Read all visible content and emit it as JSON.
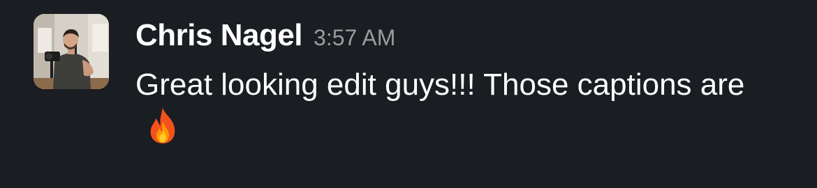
{
  "message": {
    "sender": "Chris Nagel",
    "timestamp": "3:57 AM",
    "text": "Great looking edit guys!!! Those captions are",
    "emoji": "fire-icon",
    "avatar": "user-avatar-photo"
  },
  "colors": {
    "background": "#1a1d21",
    "sender": "#ffffff",
    "timestamp": "#9a9b9d",
    "text": "#ffffff",
    "fire_outer": "#f4511e",
    "fire_inner": "#ffca28"
  }
}
